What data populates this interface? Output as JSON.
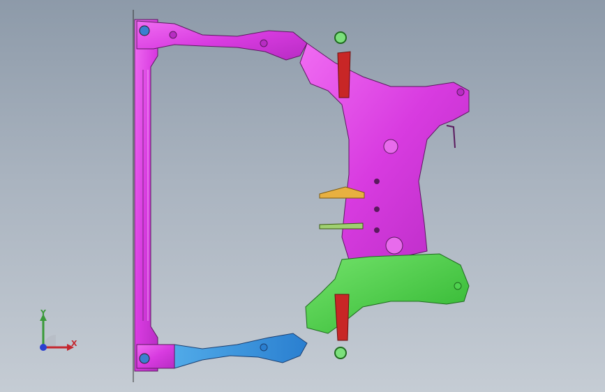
{
  "viewport": {
    "background_top": "#8d9aa9",
    "background_bottom": "#c5ccd4"
  },
  "model": {
    "parts": [
      {
        "name": "front-cross-member",
        "color": "#e040e6"
      },
      {
        "name": "left-side-rail",
        "color": "#cc33d6"
      },
      {
        "name": "right-side-rail-upper",
        "color": "#cc33d6"
      },
      {
        "name": "right-side-rail-lower",
        "color": "#3fa0e0"
      },
      {
        "name": "main-subframe-body",
        "color": "#e24be6"
      },
      {
        "name": "rear-reinforcement",
        "color": "#4fd24f"
      },
      {
        "name": "mount-brackets",
        "color": "#d02a2a"
      },
      {
        "name": "bushings",
        "color": "#6fd06f"
      },
      {
        "name": "tabs",
        "color": "#e0a030"
      }
    ]
  },
  "triad": {
    "x_label": "X",
    "y_label": "Y",
    "x_color": "#c4262e",
    "y_color": "#3a9a3a",
    "z_color": "#2a3fd0"
  }
}
